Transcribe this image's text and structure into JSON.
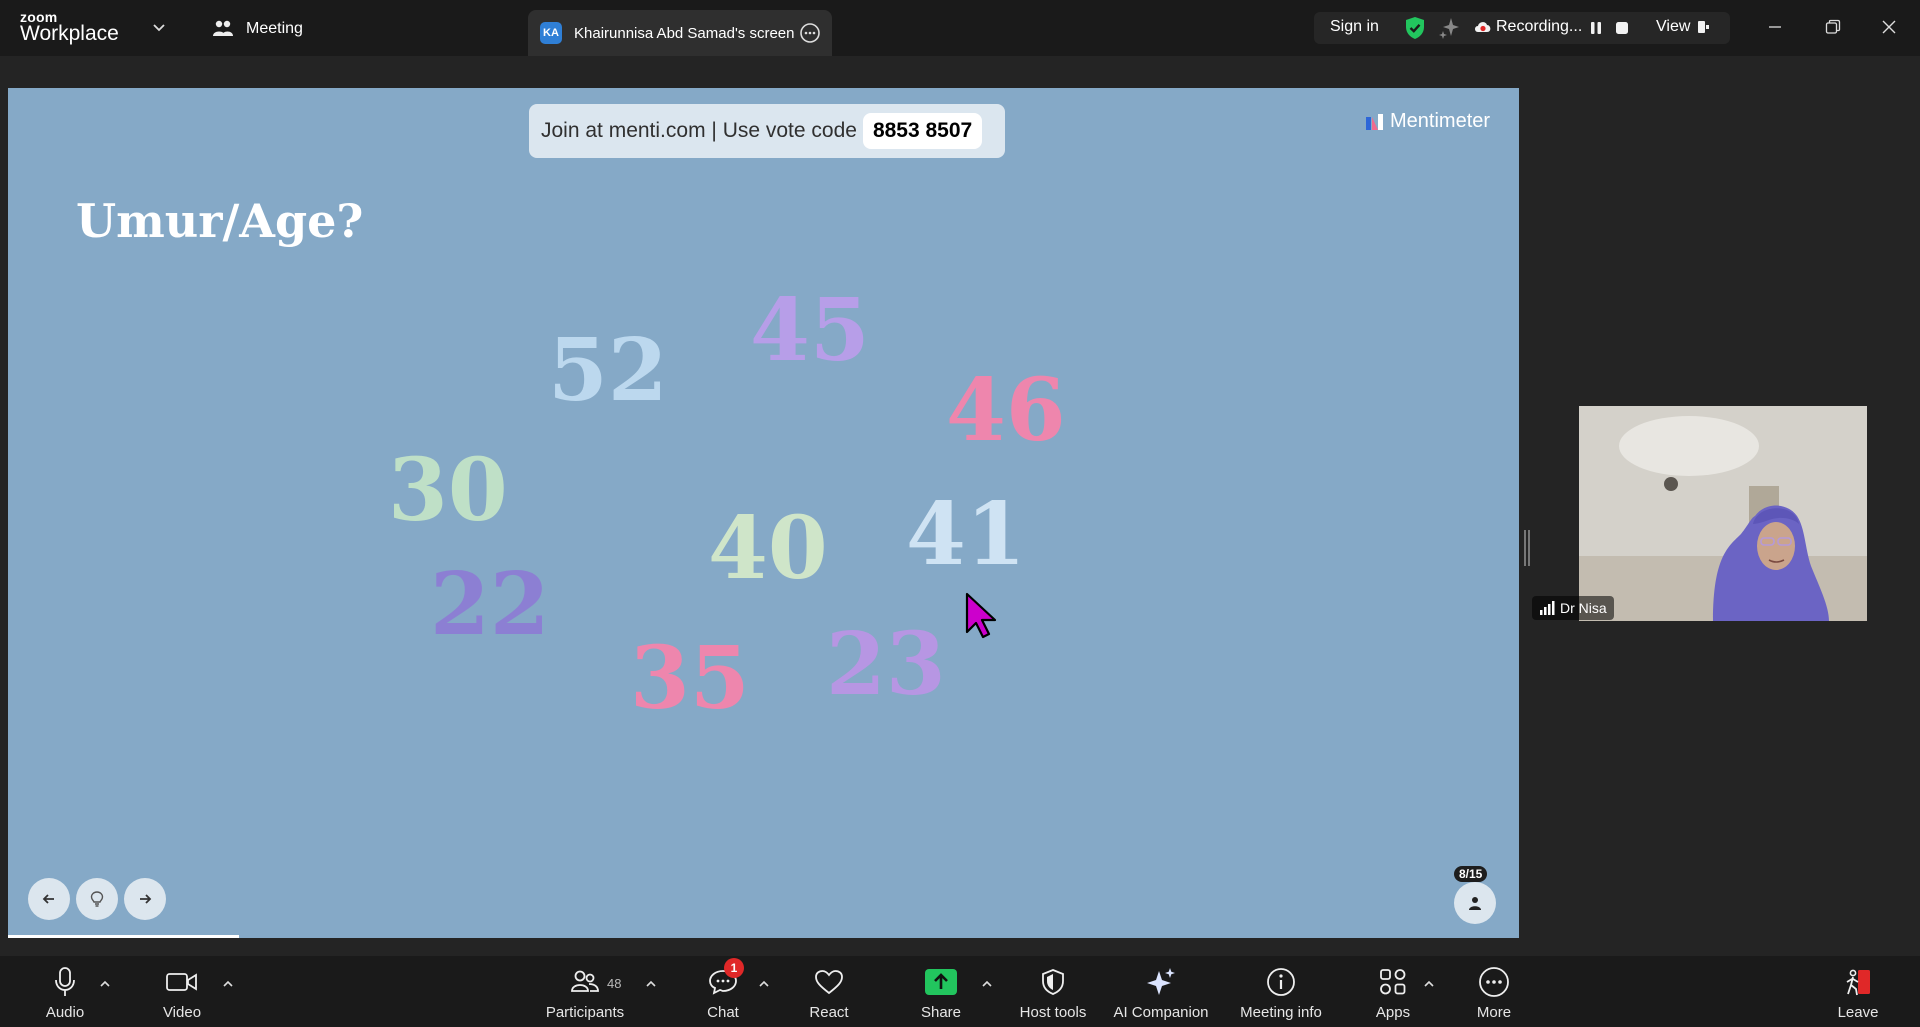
{
  "app": {
    "logo_line1": "zoom",
    "logo_line2": "Workplace"
  },
  "tabs": {
    "meeting_label": "Meeting",
    "share_avatar_initials": "KA",
    "share_label": "Khairunnisa Abd Samad's screen"
  },
  "header": {
    "sign_in": "Sign in",
    "recording_label": "Recording...",
    "view_label": "View"
  },
  "slide": {
    "banner_text": "Join at menti.com | Use vote code",
    "vote_code": "8853 8507",
    "brand": "Mentimeter",
    "title": "Umur/Age?",
    "counter": "8/15",
    "progress_fraction": 0.153,
    "words": [
      {
        "text": "45",
        "color": "#b79ee8"
      },
      {
        "text": "52",
        "color": "#bcd8ee"
      },
      {
        "text": "46",
        "color": "#ee86ad"
      },
      {
        "text": "30",
        "color": "#bfe0c7"
      },
      {
        "text": "40",
        "color": "#cfe5c9"
      },
      {
        "text": "41",
        "color": "#cfe3f3"
      },
      {
        "text": "22",
        "color": "#8c7fd3"
      },
      {
        "text": "23",
        "color": "#b796e3"
      },
      {
        "text": "35",
        "color": "#ee86ad"
      }
    ]
  },
  "participant": {
    "name": "Dr Nisa"
  },
  "toolbar": {
    "audio": "Audio",
    "video": "Video",
    "participants": "Participants",
    "participant_count": "48",
    "chat": "Chat",
    "chat_badge": "1",
    "react": "React",
    "share": "Share",
    "host_tools": "Host tools",
    "ai_companion": "AI Companion",
    "meeting_info": "Meeting info",
    "apps": "Apps",
    "more": "More",
    "leave": "Leave"
  },
  "colors": {
    "slide_background": "#85a9c7",
    "share_green": "#22c55e",
    "shield_green": "#22c55e",
    "leave_red": "#e02828",
    "cursor_magenta": "#cc00cc"
  }
}
